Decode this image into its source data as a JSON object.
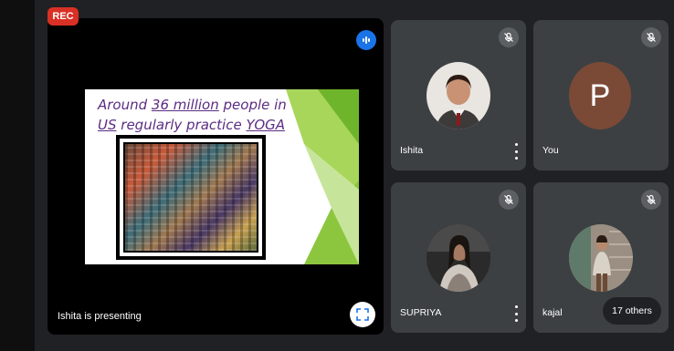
{
  "recording": {
    "label": "REC"
  },
  "main": {
    "presenter_label": "Ishita is presenting",
    "slide": {
      "title_parts": [
        "Around ",
        "36 million",
        " people in ",
        "US",
        " regularly practice ",
        "YOGA"
      ],
      "accent_color": "#5b2c83",
      "green_color": "#7cbf3a"
    }
  },
  "participants": [
    {
      "name": "Ishita",
      "avatar": "photo",
      "muted": true,
      "more_menu": true
    },
    {
      "name": "You",
      "avatar": "letter",
      "initial": "P",
      "avatar_color": "#7b4a37",
      "muted": true,
      "more_menu": false
    },
    {
      "name": "SUPRIYA",
      "avatar": "photo",
      "muted": true,
      "more_menu": true
    },
    {
      "name": "kajal",
      "avatar": "photo",
      "muted": true,
      "more_menu": false
    }
  ],
  "others": {
    "label": "17 others"
  },
  "colors": {
    "background": "#202124",
    "tile": "#3c4043",
    "rec": "#d93025",
    "active_speaker": "#1a73e8"
  }
}
